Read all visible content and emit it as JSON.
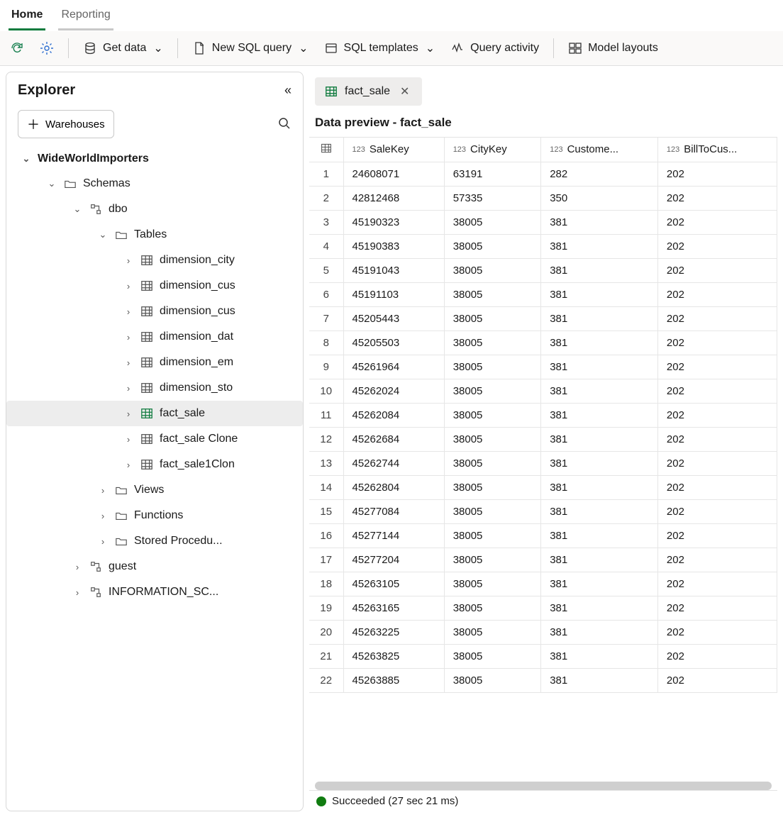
{
  "tabs": {
    "home": "Home",
    "reporting": "Reporting"
  },
  "toolbar": {
    "get_data": "Get data",
    "new_sql": "New SQL query",
    "sql_templates": "SQL templates",
    "query_activity": "Query activity",
    "model_layouts": "Model layouts"
  },
  "explorer": {
    "title": "Explorer",
    "warehouses_btn": "Warehouses",
    "tree": {
      "root": "WideWorldImporters",
      "schemas": "Schemas",
      "dbo": "dbo",
      "tables": "Tables",
      "table_items": [
        "dimension_city",
        "dimension_cus",
        "dimension_cus",
        "dimension_dat",
        "dimension_em",
        "dimension_sto",
        "fact_sale",
        "fact_sale Clone",
        "fact_sale1Clon"
      ],
      "views": "Views",
      "functions": "Functions",
      "stored_proc": "Stored Procedu...",
      "guest": "guest",
      "info_schema": "INFORMATION_SC..."
    }
  },
  "content": {
    "tab_label": "fact_sale",
    "preview_title": "Data preview - fact_sale",
    "columns": [
      {
        "type": "123",
        "label": "SaleKey"
      },
      {
        "type": "123",
        "label": "CityKey"
      },
      {
        "type": "123",
        "label": "Custome..."
      },
      {
        "type": "123",
        "label": "BillToCus..."
      }
    ],
    "rows": [
      [
        1,
        "24608071",
        "63191",
        "282",
        "202"
      ],
      [
        2,
        "42812468",
        "57335",
        "350",
        "202"
      ],
      [
        3,
        "45190323",
        "38005",
        "381",
        "202"
      ],
      [
        4,
        "45190383",
        "38005",
        "381",
        "202"
      ],
      [
        5,
        "45191043",
        "38005",
        "381",
        "202"
      ],
      [
        6,
        "45191103",
        "38005",
        "381",
        "202"
      ],
      [
        7,
        "45205443",
        "38005",
        "381",
        "202"
      ],
      [
        8,
        "45205503",
        "38005",
        "381",
        "202"
      ],
      [
        9,
        "45261964",
        "38005",
        "381",
        "202"
      ],
      [
        10,
        "45262024",
        "38005",
        "381",
        "202"
      ],
      [
        11,
        "45262084",
        "38005",
        "381",
        "202"
      ],
      [
        12,
        "45262684",
        "38005",
        "381",
        "202"
      ],
      [
        13,
        "45262744",
        "38005",
        "381",
        "202"
      ],
      [
        14,
        "45262804",
        "38005",
        "381",
        "202"
      ],
      [
        15,
        "45277084",
        "38005",
        "381",
        "202"
      ],
      [
        16,
        "45277144",
        "38005",
        "381",
        "202"
      ],
      [
        17,
        "45277204",
        "38005",
        "381",
        "202"
      ],
      [
        18,
        "45263105",
        "38005",
        "381",
        "202"
      ],
      [
        19,
        "45263165",
        "38005",
        "381",
        "202"
      ],
      [
        20,
        "45263225",
        "38005",
        "381",
        "202"
      ],
      [
        21,
        "45263825",
        "38005",
        "381",
        "202"
      ],
      [
        22,
        "45263885",
        "38005",
        "381",
        "202"
      ]
    ],
    "status": "Succeeded (27 sec 21 ms)"
  }
}
